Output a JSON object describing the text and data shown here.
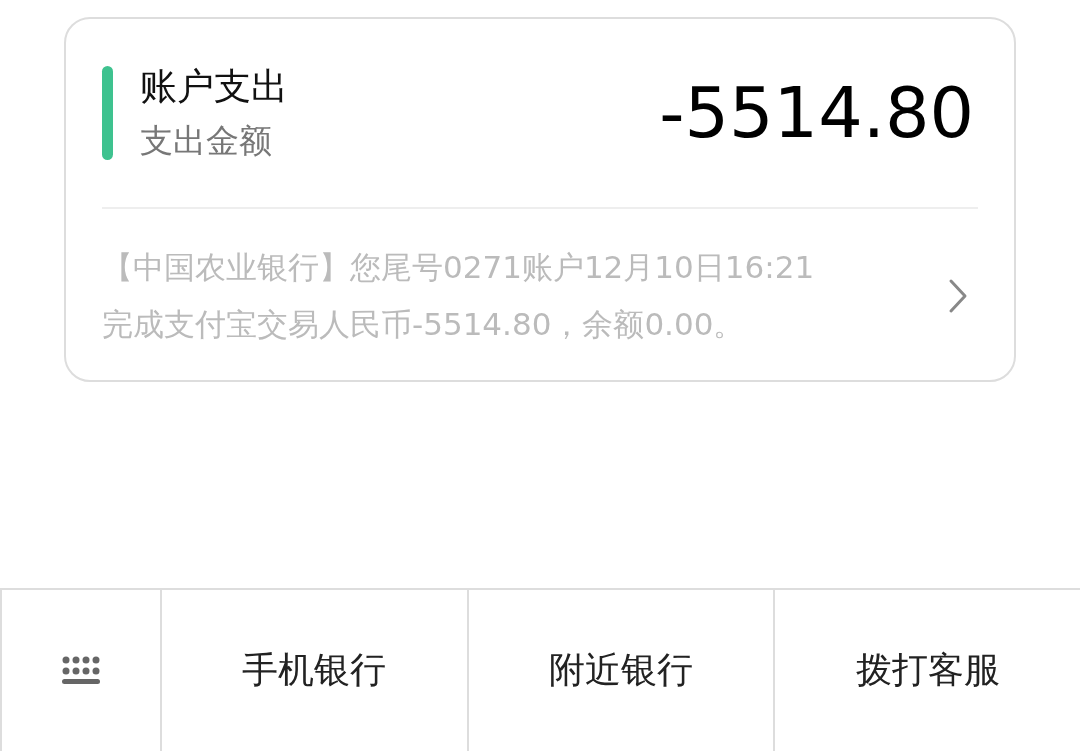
{
  "card": {
    "title": "账户支出",
    "subtitle": "支出金额",
    "amount": "-5514.80",
    "message_lines": [
      "【中国农业银行】您尾号0271账户12月10日16:21",
      "完成支付宝交易人民币-5514.80，余额0.00。"
    ]
  },
  "bottom_menu": [
    "手机银行",
    "附近银行",
    "拨打客服"
  ]
}
